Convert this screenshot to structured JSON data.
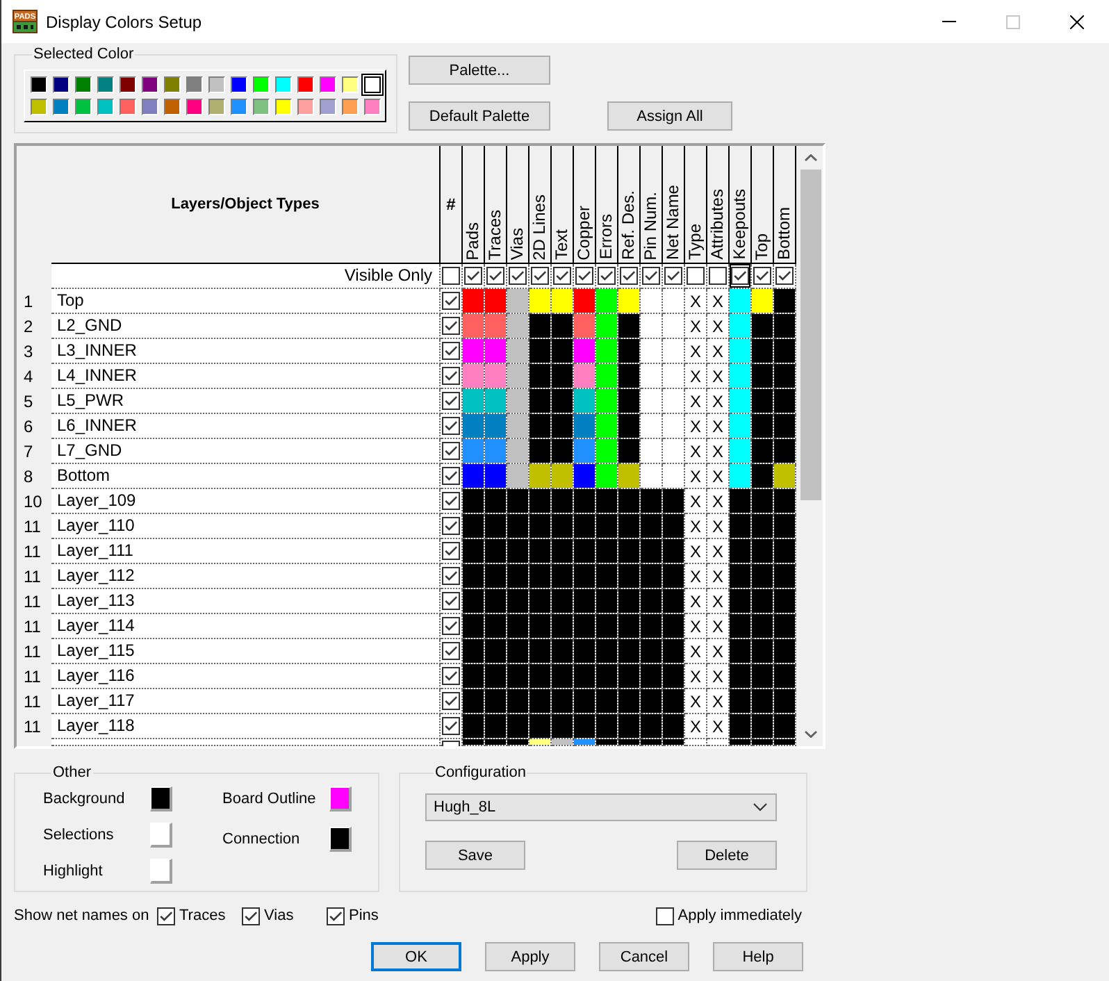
{
  "window": {
    "title": "Display Colors Setup",
    "logo_text": "PADS",
    "controls": [
      {
        "kind": "minimize",
        "disabled": false
      },
      {
        "kind": "maximize",
        "disabled": true
      },
      {
        "kind": "close",
        "disabled": false
      }
    ]
  },
  "selected_color": {
    "label": "Selected Color",
    "palette": [
      {
        "color": "#000000",
        "selected": false
      },
      {
        "color": "#000080",
        "selected": false
      },
      {
        "color": "#008000",
        "selected": false
      },
      {
        "color": "#008080",
        "selected": false
      },
      {
        "color": "#800000",
        "selected": false
      },
      {
        "color": "#800080",
        "selected": false
      },
      {
        "color": "#808000",
        "selected": false
      },
      {
        "color": "#808080",
        "selected": false
      },
      {
        "color": "#c0c0c0",
        "selected": false
      },
      {
        "color": "#0000ff",
        "selected": false
      },
      {
        "color": "#00ff00",
        "selected": false
      },
      {
        "color": "#00ffff",
        "selected": false
      },
      {
        "color": "#ff0000",
        "selected": false
      },
      {
        "color": "#ff00ff",
        "selected": false
      },
      {
        "color": "#ffff80",
        "selected": false
      },
      {
        "color": "#ffffff",
        "selected": true
      },
      {
        "color": "#c0c000",
        "selected": false
      },
      {
        "color": "#0080c0",
        "selected": false
      },
      {
        "color": "#00c040",
        "selected": false
      },
      {
        "color": "#00c0c0",
        "selected": false
      },
      {
        "color": "#ff6060",
        "selected": false
      },
      {
        "color": "#8080c0",
        "selected": false
      },
      {
        "color": "#c06000",
        "selected": false
      },
      {
        "color": "#ff0080",
        "selected": false
      },
      {
        "color": "#b0b070",
        "selected": false
      },
      {
        "color": "#2090ff",
        "selected": false
      },
      {
        "color": "#80c080",
        "selected": false
      },
      {
        "color": "#ffff00",
        "selected": false
      },
      {
        "color": "#ffa0a0",
        "selected": false
      },
      {
        "color": "#a0a0d0",
        "selected": false
      },
      {
        "color": "#ffa050",
        "selected": false
      },
      {
        "color": "#ff80c0",
        "selected": false
      }
    ]
  },
  "top_buttons": [
    {
      "label": "Palette..."
    },
    {
      "label": "Default Palette"
    },
    {
      "label": "Assign All"
    }
  ],
  "table": {
    "title": "Layers/Object Types",
    "visible_only_label": "Visible Only",
    "columns": [
      {
        "label": "#",
        "kind": "check",
        "visible_only": false,
        "focused": false
      },
      {
        "label": "Pads",
        "kind": "color",
        "visible_only": true,
        "focused": false
      },
      {
        "label": "Traces",
        "kind": "color",
        "visible_only": true,
        "focused": false
      },
      {
        "label": "Vias",
        "kind": "color",
        "visible_only": true,
        "focused": false
      },
      {
        "label": "2D Lines",
        "kind": "color",
        "visible_only": true,
        "focused": false
      },
      {
        "label": "Text",
        "kind": "color",
        "visible_only": true,
        "focused": false
      },
      {
        "label": "Copper",
        "kind": "color",
        "visible_only": true,
        "focused": false
      },
      {
        "label": "Errors",
        "kind": "color",
        "visible_only": true,
        "focused": false
      },
      {
        "label": "Ref. Des.",
        "kind": "color",
        "visible_only": true,
        "focused": false
      },
      {
        "label": "Pin Num.",
        "kind": "color",
        "visible_only": true,
        "focused": false
      },
      {
        "label": "Net Name",
        "kind": "color",
        "visible_only": true,
        "focused": false
      },
      {
        "label": "Type",
        "kind": "color",
        "visible_only": false,
        "focused": false
      },
      {
        "label": "Attributes",
        "kind": "color",
        "visible_only": false,
        "focused": false
      },
      {
        "label": "Keepouts",
        "kind": "color",
        "visible_only": true,
        "focused": true
      },
      {
        "label": "Top",
        "kind": "color",
        "visible_only": true,
        "focused": false
      },
      {
        "label": "Bottom",
        "kind": "color",
        "visible_only": true,
        "focused": false
      }
    ],
    "rows": [
      {
        "number": "1",
        "name": "Top",
        "cells": [
          {
            "kind": "check",
            "checked": true
          },
          {
            "kind": "swatch",
            "color": "#ff0000"
          },
          {
            "kind": "swatch",
            "color": "#ff0000"
          },
          {
            "kind": "swatch",
            "color": "#c0c0c0"
          },
          {
            "kind": "swatch",
            "color": "#ffff00"
          },
          {
            "kind": "swatch",
            "color": "#ffff00"
          },
          {
            "kind": "swatch",
            "color": "#ff0000"
          },
          {
            "kind": "swatch",
            "color": "#00ff00"
          },
          {
            "kind": "swatch",
            "color": "#ffff00"
          },
          {
            "kind": "swatch",
            "color": "#ffffff"
          },
          {
            "kind": "swatch",
            "color": "#ffffff"
          },
          {
            "kind": "na",
            "text": "X"
          },
          {
            "kind": "na",
            "text": "X"
          },
          {
            "kind": "swatch",
            "color": "#00ffff"
          },
          {
            "kind": "swatch",
            "color": "#ffff00"
          },
          {
            "kind": "swatch",
            "color": "#000000"
          }
        ]
      },
      {
        "number": "2",
        "name": "L2_GND",
        "cells": [
          {
            "kind": "check",
            "checked": true
          },
          {
            "kind": "swatch",
            "color": "#ff6060"
          },
          {
            "kind": "swatch",
            "color": "#ff6060"
          },
          {
            "kind": "swatch",
            "color": "#c0c0c0"
          },
          {
            "kind": "swatch",
            "color": "#000000"
          },
          {
            "kind": "swatch",
            "color": "#000000"
          },
          {
            "kind": "swatch",
            "color": "#ff6060"
          },
          {
            "kind": "swatch",
            "color": "#00ff00"
          },
          {
            "kind": "swatch",
            "color": "#000000"
          },
          {
            "kind": "swatch",
            "color": "#ffffff"
          },
          {
            "kind": "swatch",
            "color": "#ffffff"
          },
          {
            "kind": "na",
            "text": "X"
          },
          {
            "kind": "na",
            "text": "X"
          },
          {
            "kind": "swatch",
            "color": "#00ffff"
          },
          {
            "kind": "swatch",
            "color": "#000000"
          },
          {
            "kind": "swatch",
            "color": "#000000"
          }
        ]
      },
      {
        "number": "3",
        "name": "L3_INNER",
        "cells": [
          {
            "kind": "check",
            "checked": true
          },
          {
            "kind": "swatch",
            "color": "#ff00ff"
          },
          {
            "kind": "swatch",
            "color": "#ff00ff"
          },
          {
            "kind": "swatch",
            "color": "#c0c0c0"
          },
          {
            "kind": "swatch",
            "color": "#000000"
          },
          {
            "kind": "swatch",
            "color": "#000000"
          },
          {
            "kind": "swatch",
            "color": "#ff00ff"
          },
          {
            "kind": "swatch",
            "color": "#00ff00"
          },
          {
            "kind": "swatch",
            "color": "#000000"
          },
          {
            "kind": "swatch",
            "color": "#ffffff"
          },
          {
            "kind": "swatch",
            "color": "#ffffff"
          },
          {
            "kind": "na",
            "text": "X"
          },
          {
            "kind": "na",
            "text": "X"
          },
          {
            "kind": "swatch",
            "color": "#00ffff"
          },
          {
            "kind": "swatch",
            "color": "#000000"
          },
          {
            "kind": "swatch",
            "color": "#000000"
          }
        ]
      },
      {
        "number": "4",
        "name": "L4_INNER",
        "cells": [
          {
            "kind": "check",
            "checked": true
          },
          {
            "kind": "swatch",
            "color": "#ff80c0"
          },
          {
            "kind": "swatch",
            "color": "#ff80c0"
          },
          {
            "kind": "swatch",
            "color": "#c0c0c0"
          },
          {
            "kind": "swatch",
            "color": "#000000"
          },
          {
            "kind": "swatch",
            "color": "#000000"
          },
          {
            "kind": "swatch",
            "color": "#ff80c0"
          },
          {
            "kind": "swatch",
            "color": "#00ff00"
          },
          {
            "kind": "swatch",
            "color": "#000000"
          },
          {
            "kind": "swatch",
            "color": "#ffffff"
          },
          {
            "kind": "swatch",
            "color": "#ffffff"
          },
          {
            "kind": "na",
            "text": "X"
          },
          {
            "kind": "na",
            "text": "X"
          },
          {
            "kind": "swatch",
            "color": "#00ffff"
          },
          {
            "kind": "swatch",
            "color": "#000000"
          },
          {
            "kind": "swatch",
            "color": "#000000"
          }
        ]
      },
      {
        "number": "5",
        "name": "L5_PWR",
        "cells": [
          {
            "kind": "check",
            "checked": true
          },
          {
            "kind": "swatch",
            "color": "#00c0c0"
          },
          {
            "kind": "swatch",
            "color": "#00c0c0"
          },
          {
            "kind": "swatch",
            "color": "#c0c0c0"
          },
          {
            "kind": "swatch",
            "color": "#000000"
          },
          {
            "kind": "swatch",
            "color": "#000000"
          },
          {
            "kind": "swatch",
            "color": "#00c0c0"
          },
          {
            "kind": "swatch",
            "color": "#00ff00"
          },
          {
            "kind": "swatch",
            "color": "#000000"
          },
          {
            "kind": "swatch",
            "color": "#ffffff"
          },
          {
            "kind": "swatch",
            "color": "#ffffff"
          },
          {
            "kind": "na",
            "text": "X"
          },
          {
            "kind": "na",
            "text": "X"
          },
          {
            "kind": "swatch",
            "color": "#00ffff"
          },
          {
            "kind": "swatch",
            "color": "#000000"
          },
          {
            "kind": "swatch",
            "color": "#000000"
          }
        ]
      },
      {
        "number": "6",
        "name": "L6_INNER",
        "cells": [
          {
            "kind": "check",
            "checked": true
          },
          {
            "kind": "swatch",
            "color": "#0080c0"
          },
          {
            "kind": "swatch",
            "color": "#0080c0"
          },
          {
            "kind": "swatch",
            "color": "#c0c0c0"
          },
          {
            "kind": "swatch",
            "color": "#000000"
          },
          {
            "kind": "swatch",
            "color": "#000000"
          },
          {
            "kind": "swatch",
            "color": "#0080c0"
          },
          {
            "kind": "swatch",
            "color": "#00ff00"
          },
          {
            "kind": "swatch",
            "color": "#000000"
          },
          {
            "kind": "swatch",
            "color": "#ffffff"
          },
          {
            "kind": "swatch",
            "color": "#ffffff"
          },
          {
            "kind": "na",
            "text": "X"
          },
          {
            "kind": "na",
            "text": "X"
          },
          {
            "kind": "swatch",
            "color": "#00ffff"
          },
          {
            "kind": "swatch",
            "color": "#000000"
          },
          {
            "kind": "swatch",
            "color": "#000000"
          }
        ]
      },
      {
        "number": "7",
        "name": "L7_GND",
        "cells": [
          {
            "kind": "check",
            "checked": true
          },
          {
            "kind": "swatch",
            "color": "#2090ff"
          },
          {
            "kind": "swatch",
            "color": "#2090ff"
          },
          {
            "kind": "swatch",
            "color": "#c0c0c0"
          },
          {
            "kind": "swatch",
            "color": "#000000"
          },
          {
            "kind": "swatch",
            "color": "#000000"
          },
          {
            "kind": "swatch",
            "color": "#2090ff"
          },
          {
            "kind": "swatch",
            "color": "#00ff00"
          },
          {
            "kind": "swatch",
            "color": "#000000"
          },
          {
            "kind": "swatch",
            "color": "#ffffff"
          },
          {
            "kind": "swatch",
            "color": "#ffffff"
          },
          {
            "kind": "na",
            "text": "X"
          },
          {
            "kind": "na",
            "text": "X"
          },
          {
            "kind": "swatch",
            "color": "#00ffff"
          },
          {
            "kind": "swatch",
            "color": "#000000"
          },
          {
            "kind": "swatch",
            "color": "#000000"
          }
        ]
      },
      {
        "number": "8",
        "name": "Bottom",
        "cells": [
          {
            "kind": "check",
            "checked": true
          },
          {
            "kind": "swatch",
            "color": "#0000ff"
          },
          {
            "kind": "swatch",
            "color": "#0000ff"
          },
          {
            "kind": "swatch",
            "color": "#c0c0c0"
          },
          {
            "kind": "swatch",
            "color": "#c0c000"
          },
          {
            "kind": "swatch",
            "color": "#c0c000"
          },
          {
            "kind": "swatch",
            "color": "#0000ff"
          },
          {
            "kind": "swatch",
            "color": "#00ff00"
          },
          {
            "kind": "swatch",
            "color": "#c0c000"
          },
          {
            "kind": "swatch",
            "color": "#ffffff"
          },
          {
            "kind": "swatch",
            "color": "#ffffff"
          },
          {
            "kind": "na",
            "text": "X"
          },
          {
            "kind": "na",
            "text": "X"
          },
          {
            "kind": "swatch",
            "color": "#00ffff"
          },
          {
            "kind": "swatch",
            "color": "#000000"
          },
          {
            "kind": "swatch",
            "color": "#c0c000"
          }
        ]
      },
      {
        "number": "10",
        "name": "Layer_109",
        "cells": [
          {
            "kind": "check",
            "checked": true
          },
          {
            "kind": "swatch",
            "color": "#000000"
          },
          {
            "kind": "swatch",
            "color": "#000000"
          },
          {
            "kind": "swatch",
            "color": "#000000"
          },
          {
            "kind": "swatch",
            "color": "#000000"
          },
          {
            "kind": "swatch",
            "color": "#000000"
          },
          {
            "kind": "swatch",
            "color": "#000000"
          },
          {
            "kind": "swatch",
            "color": "#000000"
          },
          {
            "kind": "swatch",
            "color": "#000000"
          },
          {
            "kind": "swatch",
            "color": "#000000"
          },
          {
            "kind": "swatch",
            "color": "#000000"
          },
          {
            "kind": "na",
            "text": "X"
          },
          {
            "kind": "na",
            "text": "X"
          },
          {
            "kind": "swatch",
            "color": "#000000"
          },
          {
            "kind": "swatch",
            "color": "#000000"
          },
          {
            "kind": "swatch",
            "color": "#000000"
          }
        ]
      },
      {
        "number": "11",
        "name": "Layer_110",
        "cells": [
          {
            "kind": "check",
            "checked": true
          },
          {
            "kind": "swatch",
            "color": "#000000"
          },
          {
            "kind": "swatch",
            "color": "#000000"
          },
          {
            "kind": "swatch",
            "color": "#000000"
          },
          {
            "kind": "swatch",
            "color": "#000000"
          },
          {
            "kind": "swatch",
            "color": "#000000"
          },
          {
            "kind": "swatch",
            "color": "#000000"
          },
          {
            "kind": "swatch",
            "color": "#000000"
          },
          {
            "kind": "swatch",
            "color": "#000000"
          },
          {
            "kind": "swatch",
            "color": "#000000"
          },
          {
            "kind": "swatch",
            "color": "#000000"
          },
          {
            "kind": "na",
            "text": "X"
          },
          {
            "kind": "na",
            "text": "X"
          },
          {
            "kind": "swatch",
            "color": "#000000"
          },
          {
            "kind": "swatch",
            "color": "#000000"
          },
          {
            "kind": "swatch",
            "color": "#000000"
          }
        ]
      },
      {
        "number": "11",
        "name": "Layer_111",
        "cells": [
          {
            "kind": "check",
            "checked": true
          },
          {
            "kind": "swatch",
            "color": "#000000"
          },
          {
            "kind": "swatch",
            "color": "#000000"
          },
          {
            "kind": "swatch",
            "color": "#000000"
          },
          {
            "kind": "swatch",
            "color": "#000000"
          },
          {
            "kind": "swatch",
            "color": "#000000"
          },
          {
            "kind": "swatch",
            "color": "#000000"
          },
          {
            "kind": "swatch",
            "color": "#000000"
          },
          {
            "kind": "swatch",
            "color": "#000000"
          },
          {
            "kind": "swatch",
            "color": "#000000"
          },
          {
            "kind": "swatch",
            "color": "#000000"
          },
          {
            "kind": "na",
            "text": "X"
          },
          {
            "kind": "na",
            "text": "X"
          },
          {
            "kind": "swatch",
            "color": "#000000"
          },
          {
            "kind": "swatch",
            "color": "#000000"
          },
          {
            "kind": "swatch",
            "color": "#000000"
          }
        ]
      },
      {
        "number": "11",
        "name": "Layer_112",
        "cells": [
          {
            "kind": "check",
            "checked": true
          },
          {
            "kind": "swatch",
            "color": "#000000"
          },
          {
            "kind": "swatch",
            "color": "#000000"
          },
          {
            "kind": "swatch",
            "color": "#000000"
          },
          {
            "kind": "swatch",
            "color": "#000000"
          },
          {
            "kind": "swatch",
            "color": "#000000"
          },
          {
            "kind": "swatch",
            "color": "#000000"
          },
          {
            "kind": "swatch",
            "color": "#000000"
          },
          {
            "kind": "swatch",
            "color": "#000000"
          },
          {
            "kind": "swatch",
            "color": "#000000"
          },
          {
            "kind": "swatch",
            "color": "#000000"
          },
          {
            "kind": "na",
            "text": "X"
          },
          {
            "kind": "na",
            "text": "X"
          },
          {
            "kind": "swatch",
            "color": "#000000"
          },
          {
            "kind": "swatch",
            "color": "#000000"
          },
          {
            "kind": "swatch",
            "color": "#000000"
          }
        ]
      },
      {
        "number": "11",
        "name": "Layer_113",
        "cells": [
          {
            "kind": "check",
            "checked": true
          },
          {
            "kind": "swatch",
            "color": "#000000"
          },
          {
            "kind": "swatch",
            "color": "#000000"
          },
          {
            "kind": "swatch",
            "color": "#000000"
          },
          {
            "kind": "swatch",
            "color": "#000000"
          },
          {
            "kind": "swatch",
            "color": "#000000"
          },
          {
            "kind": "swatch",
            "color": "#000000"
          },
          {
            "kind": "swatch",
            "color": "#000000"
          },
          {
            "kind": "swatch",
            "color": "#000000"
          },
          {
            "kind": "swatch",
            "color": "#000000"
          },
          {
            "kind": "swatch",
            "color": "#000000"
          },
          {
            "kind": "na",
            "text": "X"
          },
          {
            "kind": "na",
            "text": "X"
          },
          {
            "kind": "swatch",
            "color": "#000000"
          },
          {
            "kind": "swatch",
            "color": "#000000"
          },
          {
            "kind": "swatch",
            "color": "#000000"
          }
        ]
      },
      {
        "number": "11",
        "name": "Layer_114",
        "cells": [
          {
            "kind": "check",
            "checked": true
          },
          {
            "kind": "swatch",
            "color": "#000000"
          },
          {
            "kind": "swatch",
            "color": "#000000"
          },
          {
            "kind": "swatch",
            "color": "#000000"
          },
          {
            "kind": "swatch",
            "color": "#000000"
          },
          {
            "kind": "swatch",
            "color": "#000000"
          },
          {
            "kind": "swatch",
            "color": "#000000"
          },
          {
            "kind": "swatch",
            "color": "#000000"
          },
          {
            "kind": "swatch",
            "color": "#000000"
          },
          {
            "kind": "swatch",
            "color": "#000000"
          },
          {
            "kind": "swatch",
            "color": "#000000"
          },
          {
            "kind": "na",
            "text": "X"
          },
          {
            "kind": "na",
            "text": "X"
          },
          {
            "kind": "swatch",
            "color": "#000000"
          },
          {
            "kind": "swatch",
            "color": "#000000"
          },
          {
            "kind": "swatch",
            "color": "#000000"
          }
        ]
      },
      {
        "number": "11",
        "name": "Layer_115",
        "cells": [
          {
            "kind": "check",
            "checked": true
          },
          {
            "kind": "swatch",
            "color": "#000000"
          },
          {
            "kind": "swatch",
            "color": "#000000"
          },
          {
            "kind": "swatch",
            "color": "#000000"
          },
          {
            "kind": "swatch",
            "color": "#000000"
          },
          {
            "kind": "swatch",
            "color": "#000000"
          },
          {
            "kind": "swatch",
            "color": "#000000"
          },
          {
            "kind": "swatch",
            "color": "#000000"
          },
          {
            "kind": "swatch",
            "color": "#000000"
          },
          {
            "kind": "swatch",
            "color": "#000000"
          },
          {
            "kind": "swatch",
            "color": "#000000"
          },
          {
            "kind": "na",
            "text": "X"
          },
          {
            "kind": "na",
            "text": "X"
          },
          {
            "kind": "swatch",
            "color": "#000000"
          },
          {
            "kind": "swatch",
            "color": "#000000"
          },
          {
            "kind": "swatch",
            "color": "#000000"
          }
        ]
      },
      {
        "number": "11",
        "name": "Layer_116",
        "cells": [
          {
            "kind": "check",
            "checked": true
          },
          {
            "kind": "swatch",
            "color": "#000000"
          },
          {
            "kind": "swatch",
            "color": "#000000"
          },
          {
            "kind": "swatch",
            "color": "#000000"
          },
          {
            "kind": "swatch",
            "color": "#000000"
          },
          {
            "kind": "swatch",
            "color": "#000000"
          },
          {
            "kind": "swatch",
            "color": "#000000"
          },
          {
            "kind": "swatch",
            "color": "#000000"
          },
          {
            "kind": "swatch",
            "color": "#000000"
          },
          {
            "kind": "swatch",
            "color": "#000000"
          },
          {
            "kind": "swatch",
            "color": "#000000"
          },
          {
            "kind": "na",
            "text": "X"
          },
          {
            "kind": "na",
            "text": "X"
          },
          {
            "kind": "swatch",
            "color": "#000000"
          },
          {
            "kind": "swatch",
            "color": "#000000"
          },
          {
            "kind": "swatch",
            "color": "#000000"
          }
        ]
      },
      {
        "number": "11",
        "name": "Layer_117",
        "cells": [
          {
            "kind": "check",
            "checked": true
          },
          {
            "kind": "swatch",
            "color": "#000000"
          },
          {
            "kind": "swatch",
            "color": "#000000"
          },
          {
            "kind": "swatch",
            "color": "#000000"
          },
          {
            "kind": "swatch",
            "color": "#000000"
          },
          {
            "kind": "swatch",
            "color": "#000000"
          },
          {
            "kind": "swatch",
            "color": "#000000"
          },
          {
            "kind": "swatch",
            "color": "#000000"
          },
          {
            "kind": "swatch",
            "color": "#000000"
          },
          {
            "kind": "swatch",
            "color": "#000000"
          },
          {
            "kind": "swatch",
            "color": "#000000"
          },
          {
            "kind": "na",
            "text": "X"
          },
          {
            "kind": "na",
            "text": "X"
          },
          {
            "kind": "swatch",
            "color": "#000000"
          },
          {
            "kind": "swatch",
            "color": "#000000"
          },
          {
            "kind": "swatch",
            "color": "#000000"
          }
        ]
      },
      {
        "number": "11",
        "name": "Layer_118",
        "cells": [
          {
            "kind": "check",
            "checked": true
          },
          {
            "kind": "swatch",
            "color": "#000000"
          },
          {
            "kind": "swatch",
            "color": "#000000"
          },
          {
            "kind": "swatch",
            "color": "#000000"
          },
          {
            "kind": "swatch",
            "color": "#000000"
          },
          {
            "kind": "swatch",
            "color": "#000000"
          },
          {
            "kind": "swatch",
            "color": "#000000"
          },
          {
            "kind": "swatch",
            "color": "#000000"
          },
          {
            "kind": "swatch",
            "color": "#000000"
          },
          {
            "kind": "swatch",
            "color": "#000000"
          },
          {
            "kind": "swatch",
            "color": "#000000"
          },
          {
            "kind": "na",
            "text": "X"
          },
          {
            "kind": "na",
            "text": "X"
          },
          {
            "kind": "swatch",
            "color": "#000000"
          },
          {
            "kind": "swatch",
            "color": "#000000"
          },
          {
            "kind": "swatch",
            "color": "#000000"
          }
        ]
      },
      {
        "cells": [
          {
            "kind": "check"
          },
          {
            "kind": "swatch",
            "color": "#000000"
          },
          {
            "kind": "swatch",
            "color": "#000000"
          },
          {
            "kind": "swatch",
            "color": "#000000"
          },
          {
            "kind": "swatch",
            "color": "#ffff80"
          },
          {
            "kind": "swatch",
            "color": "#c0c0c0"
          },
          {
            "kind": "swatch",
            "color": "#2090ff"
          },
          {
            "kind": "swatch",
            "color": "#000000"
          },
          {
            "kind": "swatch",
            "color": "#000000"
          },
          {
            "kind": "swatch",
            "color": "#000000"
          },
          {
            "kind": "swatch",
            "color": "#000000"
          },
          {
            "kind": "na"
          },
          {
            "kind": "na"
          },
          {
            "kind": "swatch",
            "color": "#000000"
          },
          {
            "kind": "swatch",
            "color": "#000000"
          },
          {
            "kind": "swatch",
            "color": "#000000"
          }
        ]
      }
    ]
  },
  "other": {
    "title": "Other",
    "columns": [
      {
        "items": [
          {
            "label": "Background",
            "color": "#000000"
          },
          {
            "label": "Selections",
            "color": "#ffffff"
          },
          {
            "label": "Highlight",
            "color": "#ffffff"
          }
        ]
      },
      {
        "items": [
          {
            "label": "Board Outline",
            "color": "#ff00ff"
          },
          {
            "label": "Connection",
            "color": "#000000"
          }
        ]
      }
    ]
  },
  "configuration": {
    "title": "Configuration",
    "value": "Hugh_8L",
    "buttons": [
      {
        "label": "Save"
      },
      {
        "label": "Delete"
      }
    ]
  },
  "show_net_names": {
    "label": "Show net names on",
    "options": [
      {
        "label": "Traces",
        "checked": true
      },
      {
        "label": "Vias",
        "checked": true
      },
      {
        "label": "Pins",
        "checked": true
      }
    ]
  },
  "apply_immediately": {
    "label": "Apply immediately",
    "checked": false
  },
  "buttons": [
    {
      "label": "OK",
      "default": true
    },
    {
      "label": "Apply",
      "default": false
    },
    {
      "label": "Cancel",
      "default": false
    },
    {
      "label": "Help",
      "default": false
    }
  ]
}
